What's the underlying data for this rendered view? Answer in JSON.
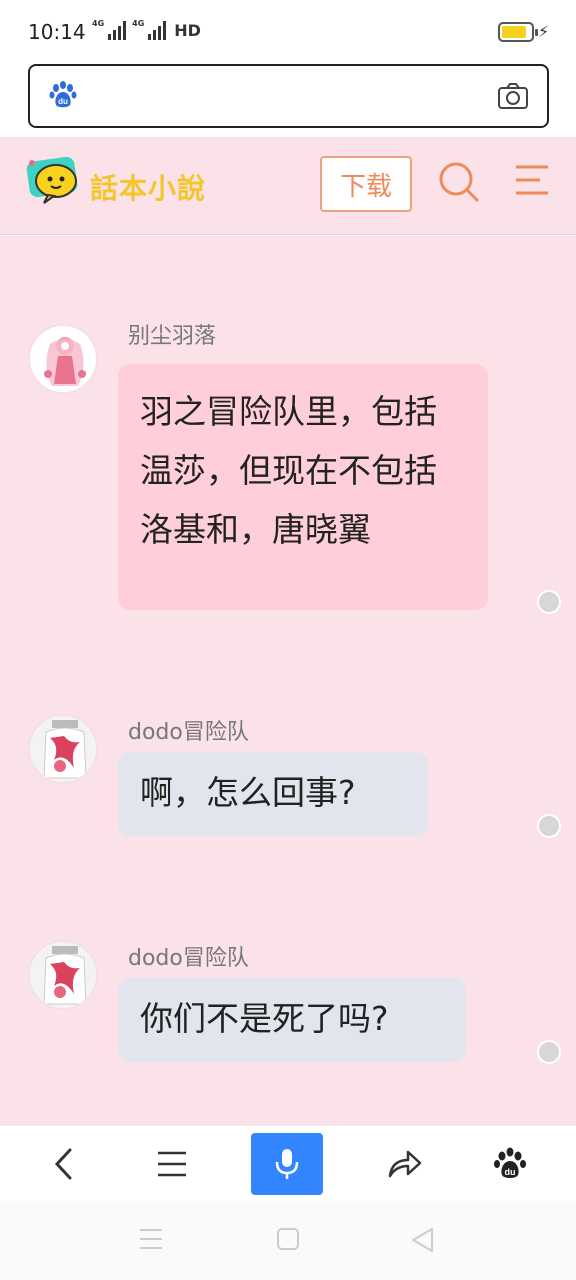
{
  "status": {
    "time": "10:14",
    "network_1": "4G",
    "network_2": "4G",
    "hd": "HD",
    "battery_level": 0.85
  },
  "browser": {
    "logo_icon": "baidu-paw-icon",
    "camera_icon": "camera-icon"
  },
  "header": {
    "logo_text": "話本小說",
    "download_label": "下载",
    "search_icon": "search-icon",
    "menu_icon": "menu-icon",
    "accent": "#ef8a5a"
  },
  "chat": {
    "background": "#fbe1e8",
    "messages": [
      {
        "author": "别尘羽落",
        "text": "羽之冒险队里，包括温莎，但现在不包括洛基和，唐晓翼",
        "bubble_color": "#ffcfd9"
      },
      {
        "author": "dodo冒险队",
        "text": "啊，怎么回事?",
        "bubble_color": "#e2e5ee"
      },
      {
        "author": "dodo冒险队",
        "text": "你们不是死了吗?",
        "bubble_color": "#e2e5ee"
      }
    ]
  },
  "bottom_nav": {
    "items": [
      "back-icon",
      "menu-icon",
      "microphone-icon",
      "share-icon",
      "baidu-paw-icon"
    ],
    "mic_color": "#3385ff"
  },
  "system_nav": {
    "items": [
      "recent-apps-icon",
      "home-icon",
      "back-triangle-icon"
    ]
  }
}
